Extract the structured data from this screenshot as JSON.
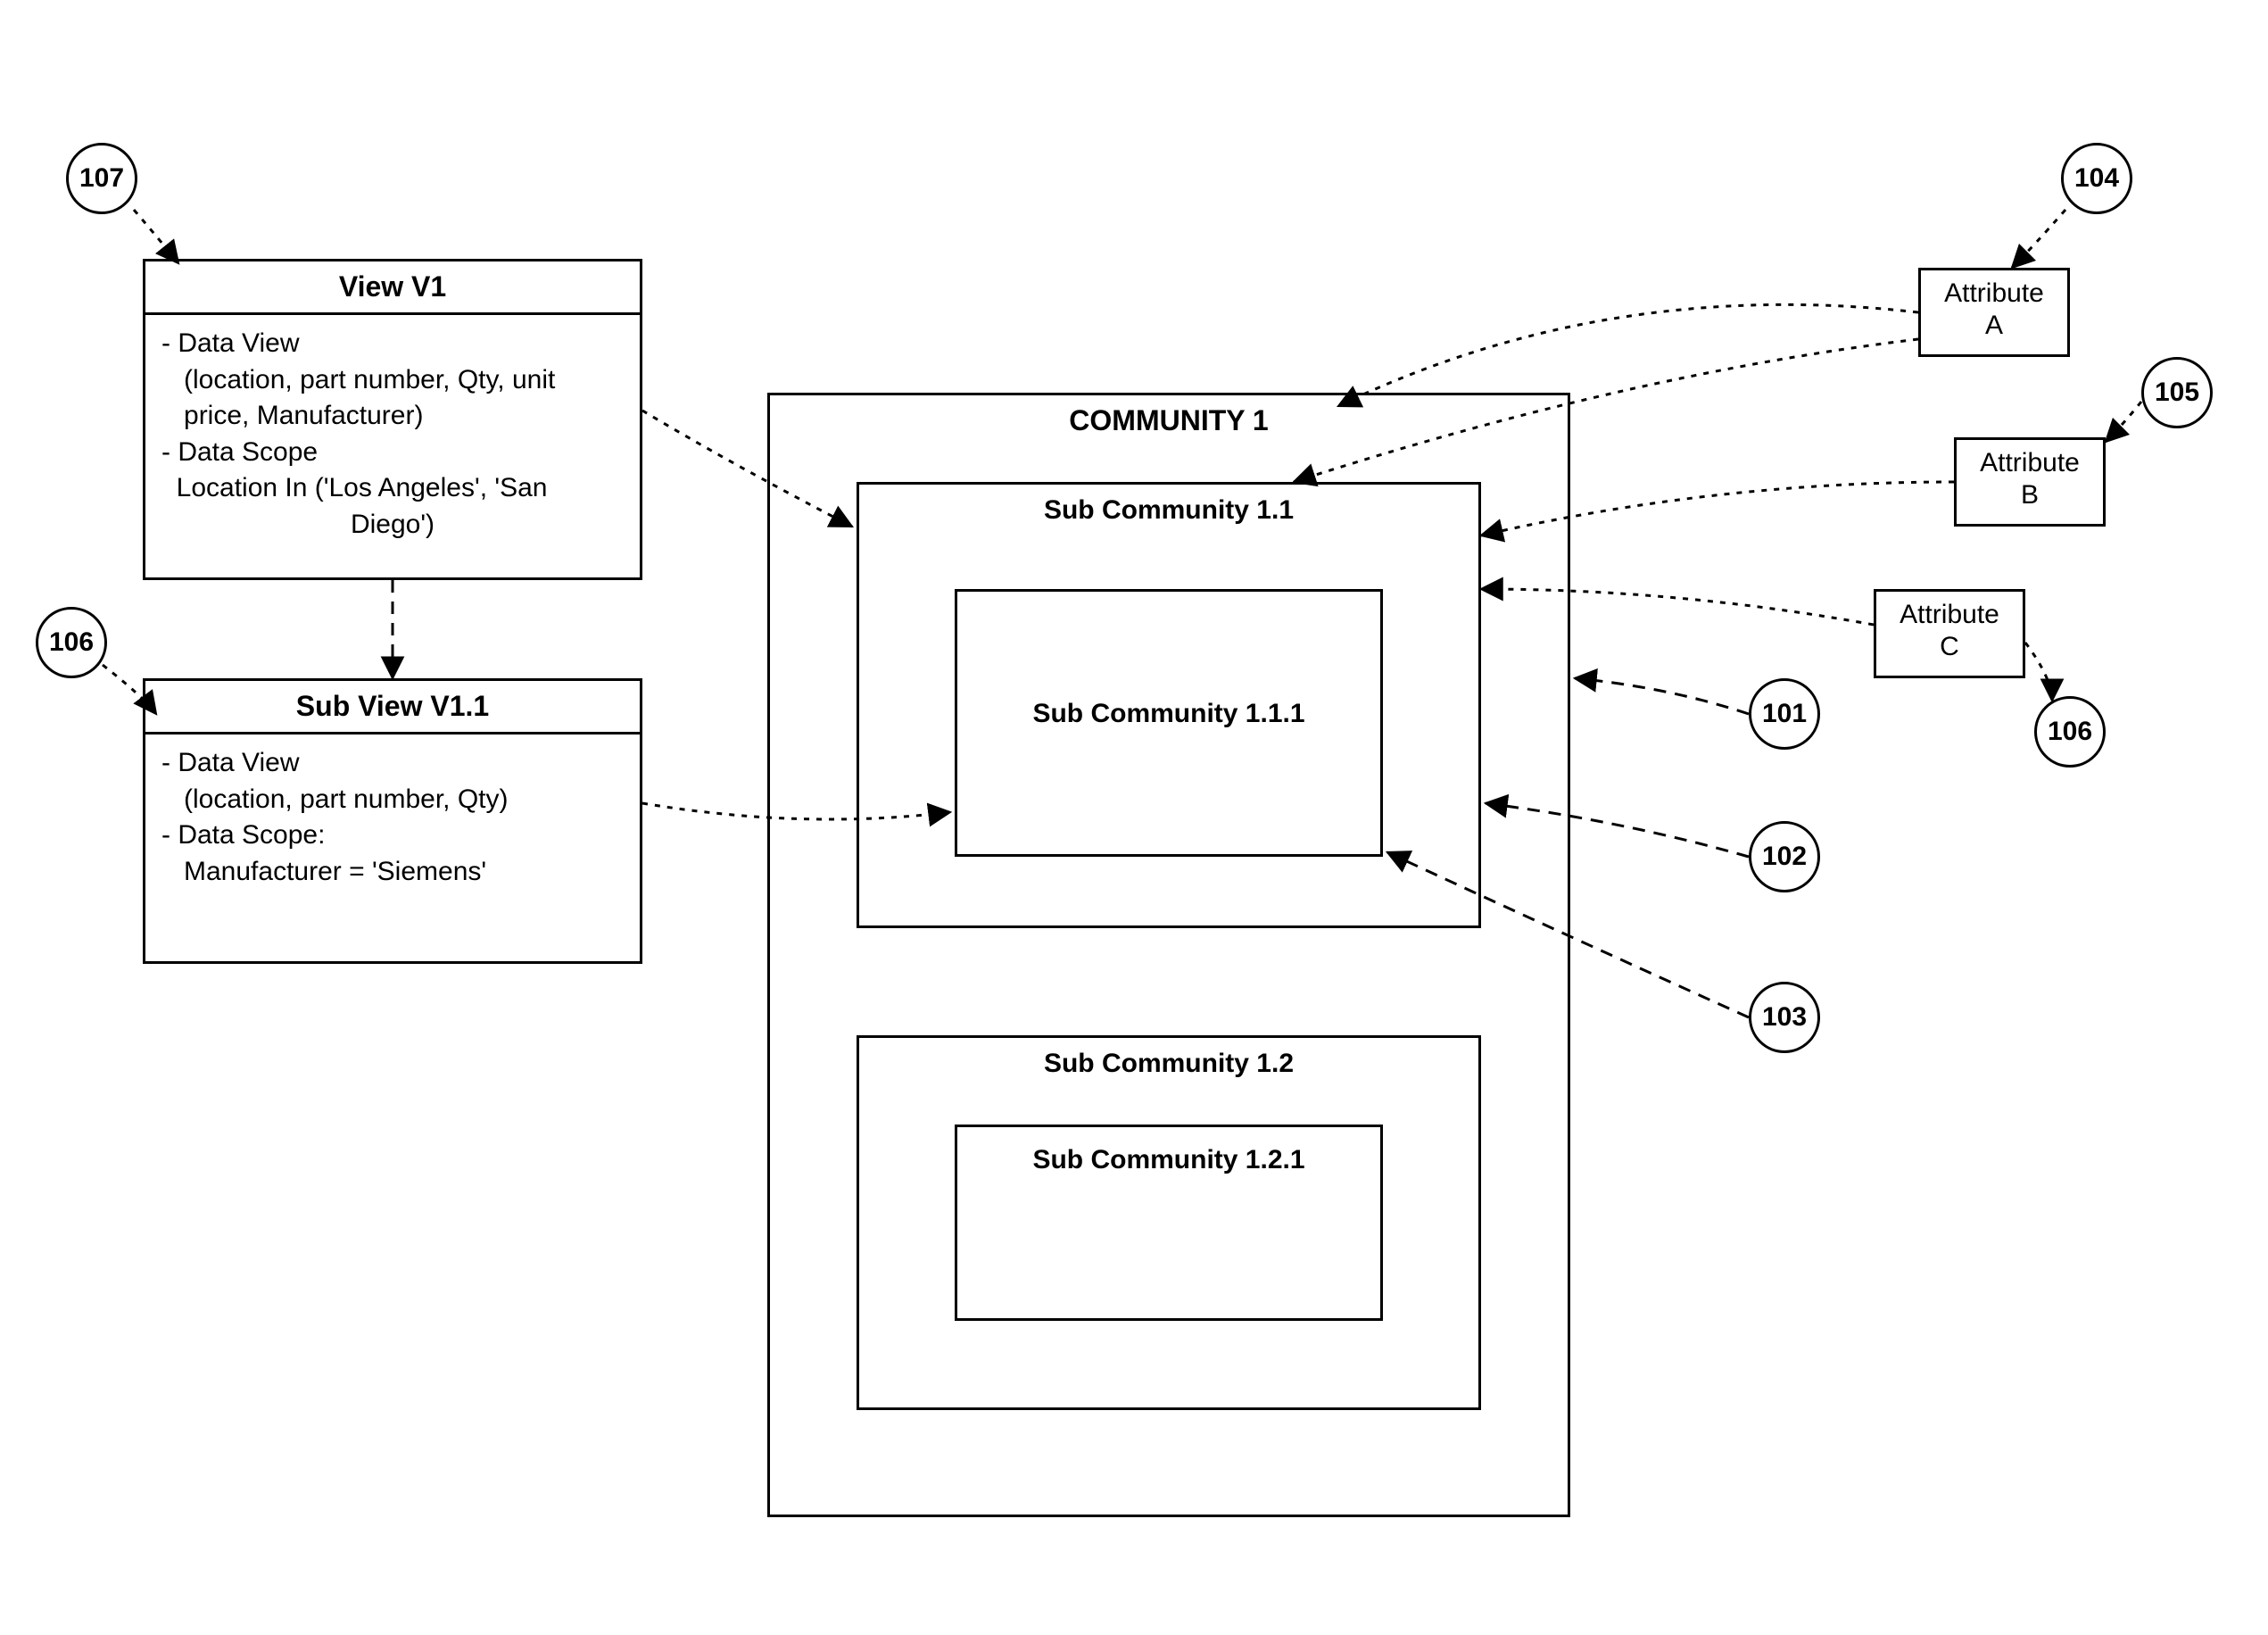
{
  "view_v1": {
    "title": "View  V1",
    "line1": "- Data View",
    "line2": "   (location, part number, Qty, unit",
    "line3": "   price, Manufacturer)",
    "line4": "- Data Scope",
    "line5": "  Location In ('Los Angeles', 'San",
    "line6": "Diego')"
  },
  "subview_v11": {
    "title": "Sub View  V1.1",
    "line1": "- Data View",
    "line2": "   (location, part number, Qty)",
    "line3": "- Data Scope:",
    "line4": "   Manufacturer = 'Siemens'"
  },
  "community": {
    "title": "COMMUNITY  1",
    "sub11": "Sub Community  1.1",
    "sub111": "Sub Community 1.1.1",
    "sub12": "Sub Community  1.2",
    "sub121": "Sub Community 1.2.1"
  },
  "attributes": {
    "a": "Attribute\nA",
    "b": "Attribute\nB",
    "c": "Attribute\nC"
  },
  "refs": {
    "r101": "101",
    "r102": "102",
    "r103": "103",
    "r104": "104",
    "r105": "105",
    "r106a": "106",
    "r106b": "106",
    "r107": "107"
  }
}
